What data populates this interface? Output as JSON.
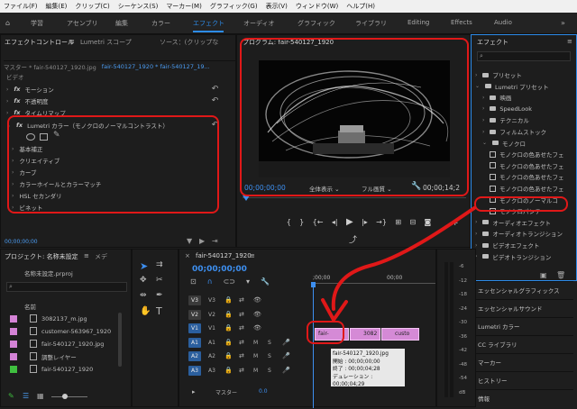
{
  "menu": [
    "ファイル(F)",
    "編集(E)",
    "クリップ(C)",
    "シーケンス(S)",
    "マーカー(M)",
    "グラフィック(G)",
    "表示(V)",
    "ウィンドウ(W)",
    "ヘルプ(H)"
  ],
  "workspaces": [
    "学習",
    "アセンブリ",
    "編集",
    "カラー",
    "エフェクト",
    "オーディオ",
    "グラフィック",
    "ライブラリ",
    "Editing",
    "Effects",
    "Audio"
  ],
  "active_workspace": "エフェクト",
  "effect_controls": {
    "tabs": [
      "エフェクトコントロール",
      "Lumetri スコープ",
      "ソース：(クリップな"
    ],
    "master": "マスター * fair-540127_1920.jpg",
    "sequence": "fair-540127_1920 * fair-540127_19...",
    "video_label": "ビデオ",
    "motion": "モーション",
    "opacity": "不透明度",
    "time_remap": "タイムリマップ",
    "lumetri": "Lumetri カラー（モノクロのノーマルコントラスト）",
    "sections": [
      "基本補正",
      "クリエイティブ",
      "カーブ",
      "カラーホイールとカラーマッチ",
      "HSL セカンダリ",
      "ビネット"
    ],
    "timecode": "00;00;00;00"
  },
  "program": {
    "title": "プログラム: fair-540127_1920",
    "timecode_left": "00;00;00;00",
    "zoom": "全体表示",
    "quality": "フル画質",
    "timecode_right": "00;00;14;2"
  },
  "effects": {
    "title": "エフェクト",
    "items": [
      {
        "label": "プリセット",
        "indent": 1,
        "type": "folder"
      },
      {
        "label": "Lumetri プリセット",
        "indent": 1,
        "type": "folder"
      },
      {
        "label": "映画",
        "indent": 2,
        "type": "folder"
      },
      {
        "label": "SpeedLook",
        "indent": 2,
        "type": "folder"
      },
      {
        "label": "テクニカル",
        "indent": 2,
        "type": "folder"
      },
      {
        "label": "フィルムストック",
        "indent": 2,
        "type": "folder"
      },
      {
        "label": "モノクロ",
        "indent": 2,
        "type": "folder"
      },
      {
        "label": "モノクロの色あせたフェ",
        "indent": 3,
        "type": "fx"
      },
      {
        "label": "モノクロの色あせたフェ",
        "indent": 3,
        "type": "fx"
      },
      {
        "label": "モノクロの色あせたフェ",
        "indent": 3,
        "type": "fx"
      },
      {
        "label": "モノクロの色あせたフェ",
        "indent": 3,
        "type": "fx"
      },
      {
        "label": "モノクロのノーマルコ",
        "indent": 3,
        "type": "fx"
      },
      {
        "label": "モノクロパンチ",
        "indent": 3,
        "type": "fx"
      },
      {
        "label": "オーディオエフェクト",
        "indent": 1,
        "type": "folder"
      },
      {
        "label": "オーディオトランジション",
        "indent": 1,
        "type": "folder"
      },
      {
        "label": "ビデオエフェクト",
        "indent": 1,
        "type": "folder"
      },
      {
        "label": "ビデオトランジション",
        "indent": 1,
        "type": "folder"
      }
    ]
  },
  "right_panels": [
    "エッセンシャルグラフィックス",
    "エッセンシャルサウンド",
    "Lumetri カラー",
    "CC ライブラリ",
    "マーカー",
    "ヒストリー",
    "情報"
  ],
  "project": {
    "tabs": [
      "プロジェクト: 名称未設定",
      "メデ"
    ],
    "file": "名称未設定.prproj",
    "column": "名前",
    "items": [
      {
        "name": "3082137_m.jpg",
        "color": "#d483d6"
      },
      {
        "name": "customer-563967_1920",
        "color": "#d483d6"
      },
      {
        "name": "fair-540127_1920.jpg",
        "color": "#d483d6"
      },
      {
        "name": "調整レイヤー",
        "color": "#d483d6"
      },
      {
        "name": "fair-540127_1920",
        "color": "#3fbf3f"
      }
    ]
  },
  "timeline": {
    "title": "fair-540127_1920",
    "timecode": "00;00;00;00",
    "ruler": [
      ";00;00",
      "00;00"
    ],
    "video_tracks": [
      "V3",
      "V2",
      "V1"
    ],
    "audio_tracks": [
      "A1",
      "A2",
      "A3"
    ],
    "clips": [
      "fair-",
      "3082",
      "custo"
    ],
    "master": "マスター",
    "master_val": "0.0",
    "tooltip": {
      "name": "fair-540127_1920.jpg",
      "start": "開始 : 00;00;00;00",
      "end": "終了 : 00;00;04;28",
      "duration": "デュレーション : 00;00;04;29"
    }
  },
  "meter_scale": [
    "-6",
    "-12",
    "-18",
    "-24",
    "-30",
    "-36",
    "-42",
    "-48",
    "-54",
    "dB"
  ]
}
